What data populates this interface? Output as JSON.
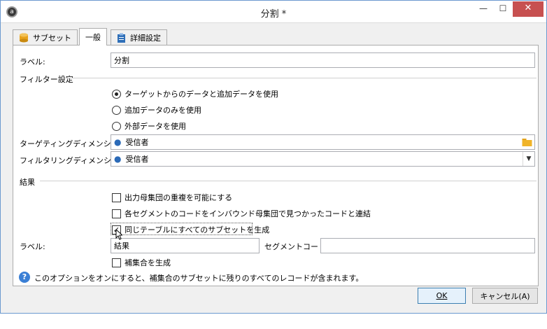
{
  "window": {
    "title": "分割 *",
    "app_icon": "app-icon"
  },
  "tabs": [
    {
      "label": "サブセット",
      "icon": "database-icon",
      "active": false
    },
    {
      "label": "一般",
      "icon": "",
      "active": true
    },
    {
      "label": "詳細設定",
      "icon": "clipboard-icon",
      "active": false
    }
  ],
  "general": {
    "label_caption": "ラベル:",
    "label_value": "分割",
    "filter_section": "フィルター設定",
    "radio_options": [
      {
        "label": "ターゲットからのデータと追加データを使用",
        "selected": true
      },
      {
        "label": "追加データのみを使用",
        "selected": false
      },
      {
        "label": "外部データを使用",
        "selected": false
      }
    ],
    "targeting_caption": "ターゲティングディメンション:",
    "targeting_value": "受信者",
    "filtering_caption": "フィルタリングディメンション:",
    "filtering_value": "受信者"
  },
  "result": {
    "section": "結果",
    "checkboxes": [
      {
        "label": "出力母集団の重複を可能にする",
        "checked": false
      },
      {
        "label": "各セグメントのコードをインバウンド母集団で見つかったコードと連結",
        "checked": false
      },
      {
        "label": "同じテーブルにすべてのサブセットを生成",
        "checked": true
      }
    ],
    "label_caption": "ラベル:",
    "label_value": "結果",
    "segment_caption": "セグメントコード:",
    "segment_value": "",
    "complement_label": "補集合を生成",
    "complement_checked": false,
    "info_text": "このオプションをオンにすると、補集合のサブセットに残りのすべてのレコードが含まれます。"
  },
  "buttons": {
    "ok": "OK",
    "cancel": "キャンセル(A)"
  }
}
